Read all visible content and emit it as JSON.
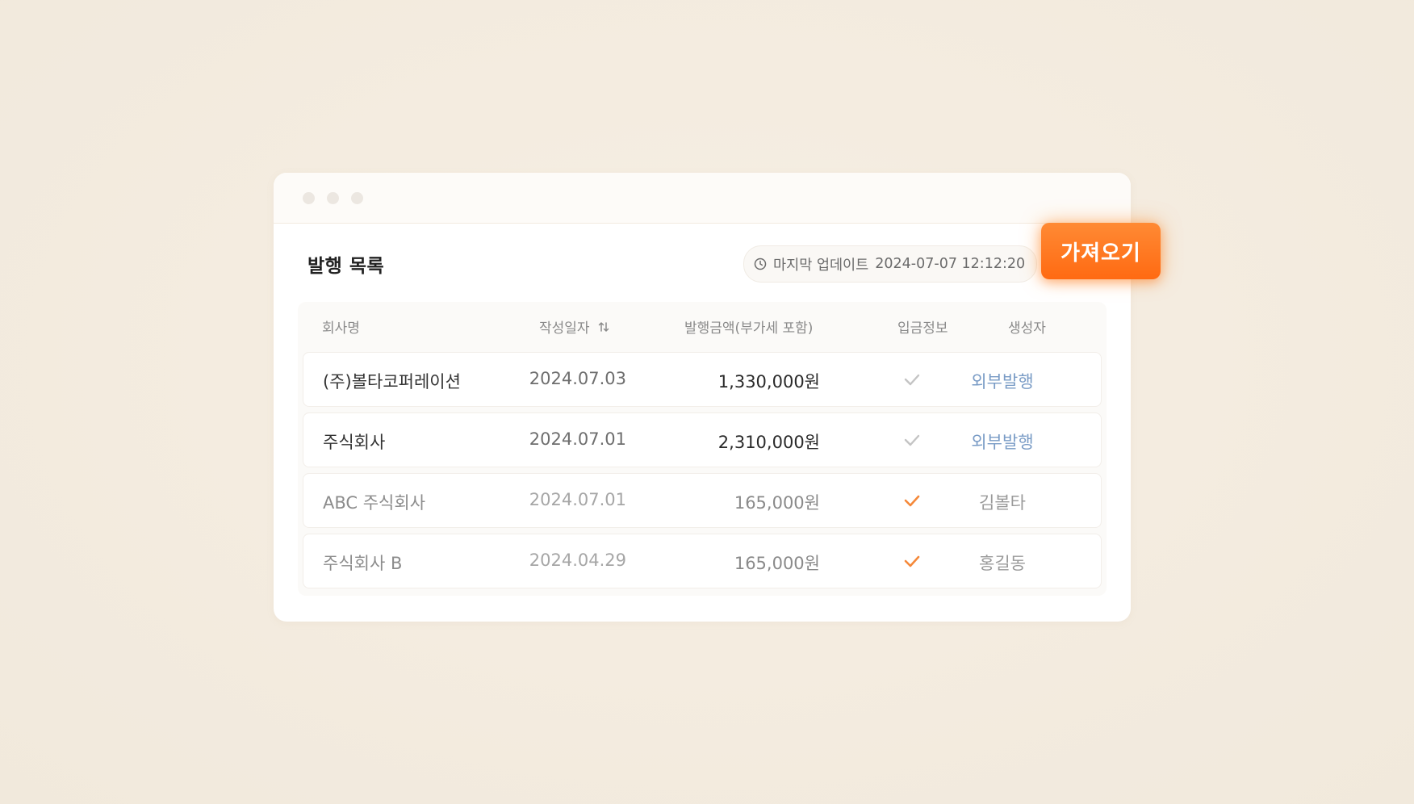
{
  "window": {
    "title_dots": [
      "dot",
      "dot",
      "dot"
    ]
  },
  "header": {
    "title": "발행 목록",
    "last_update_label": "마지막 업데이트",
    "last_update_value": "2024-07-07 12:12:20",
    "fetch_button": "가져오기"
  },
  "colors": {
    "accent": "#ff7a20",
    "check_active": "#f5893a",
    "check_inactive": "#c4c4c4",
    "external_link": "#7a9cc6"
  },
  "table": {
    "columns": {
      "company": "회사명",
      "date": "작성일자",
      "amount": "발행금액(부가세 포함)",
      "deposit": "입금정보",
      "creator": "생성자"
    },
    "rows": [
      {
        "company": "(주)볼타코퍼레이션",
        "date": "2024.07.03",
        "amount": "1,330,000원",
        "deposit_confirmed": false,
        "creator": "외부발행"
      },
      {
        "company": "주식회사",
        "date": "2024.07.01",
        "amount": "2,310,000원",
        "deposit_confirmed": false,
        "creator": "외부발행"
      },
      {
        "company": "ABC 주식회사",
        "date": "2024.07.01",
        "amount": "165,000원",
        "deposit_confirmed": true,
        "creator": "김볼타"
      },
      {
        "company": "주식회사 B",
        "date": "2024.04.29",
        "amount": "165,000원",
        "deposit_confirmed": true,
        "creator": "홍길동"
      }
    ]
  }
}
